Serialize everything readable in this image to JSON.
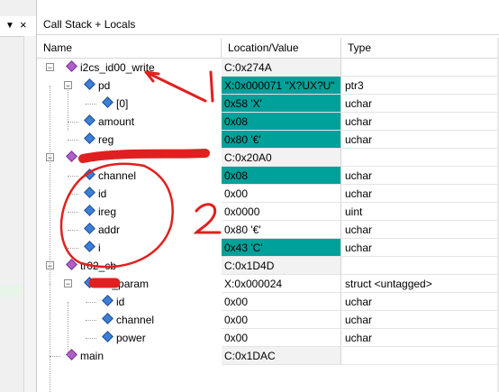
{
  "window": {
    "title": "Call Stack + Locals",
    "close_glyph": "×"
  },
  "left_pane": {
    "dropdown_glyph": "▼",
    "close_glyph": "×"
  },
  "columns": {
    "name": "Name",
    "location": "Location/Value",
    "type": "Type"
  },
  "rows": [
    {
      "name": "i2cs_id00_write",
      "location": "C:0x274A",
      "type": "",
      "kind": "func",
      "level": 0,
      "expander": "−"
    },
    {
      "name": "pd",
      "location": "X:0x000071 \"X?UX?U\"",
      "type": "ptr3",
      "kind": "var",
      "level": 1,
      "expander": "−",
      "highlight": true
    },
    {
      "name": "[0]",
      "location": "0x58 'X'",
      "type": "uchar",
      "kind": "var",
      "level": 2,
      "highlight": true
    },
    {
      "name": "amount",
      "location": "0x08",
      "type": "uchar",
      "kind": "var",
      "level": 1,
      "highlight": true
    },
    {
      "name": "reg",
      "location": "0x80 '€'",
      "type": "uchar",
      "kind": "var",
      "level": 1,
      "highlight": true
    },
    {
      "name": "",
      "location": "C:0x20A0",
      "type": "",
      "kind": "func",
      "level": 0,
      "expander": "−"
    },
    {
      "name": "channel",
      "location": "0x08",
      "type": "uchar",
      "kind": "var",
      "level": 1,
      "highlight": true
    },
    {
      "name": "id",
      "location": "0x00",
      "type": "uchar",
      "kind": "var",
      "level": 1
    },
    {
      "name": "ireg",
      "location": "0x0000",
      "type": "uint",
      "kind": "var",
      "level": 1
    },
    {
      "name": "addr",
      "location": "0x80 '€'",
      "type": "uchar",
      "kind": "var",
      "level": 1
    },
    {
      "name": "i",
      "location": "0x43 'C'",
      "type": "uchar",
      "kind": "var",
      "level": 1,
      "highlight": true
    },
    {
      "name": "tr02_cb",
      "location": "C:0x1D4D",
      "type": "",
      "kind": "func",
      "level": 0,
      "expander": "−"
    },
    {
      "name": "init_param",
      "location": "X:0x000024",
      "type": "struct <untagged>",
      "kind": "var",
      "level": 1,
      "expander": "−"
    },
    {
      "name": "id",
      "location": "0x00",
      "type": "uchar",
      "kind": "var",
      "level": 2
    },
    {
      "name": "channel",
      "location": "0x00",
      "type": "uchar",
      "kind": "var",
      "level": 2
    },
    {
      "name": "power",
      "location": "0x00",
      "type": "uchar",
      "kind": "var",
      "level": 2
    },
    {
      "name": "main",
      "location": "C:0x1DAC",
      "type": "",
      "kind": "func",
      "level": 0
    }
  ],
  "annotations": {
    "label_1": "1",
    "label_2": "2"
  },
  "colors": {
    "highlight": "#00a19a",
    "annotation": "#e02020",
    "func_icon": "#b060c8",
    "var_icon": "#3c7fd6"
  }
}
